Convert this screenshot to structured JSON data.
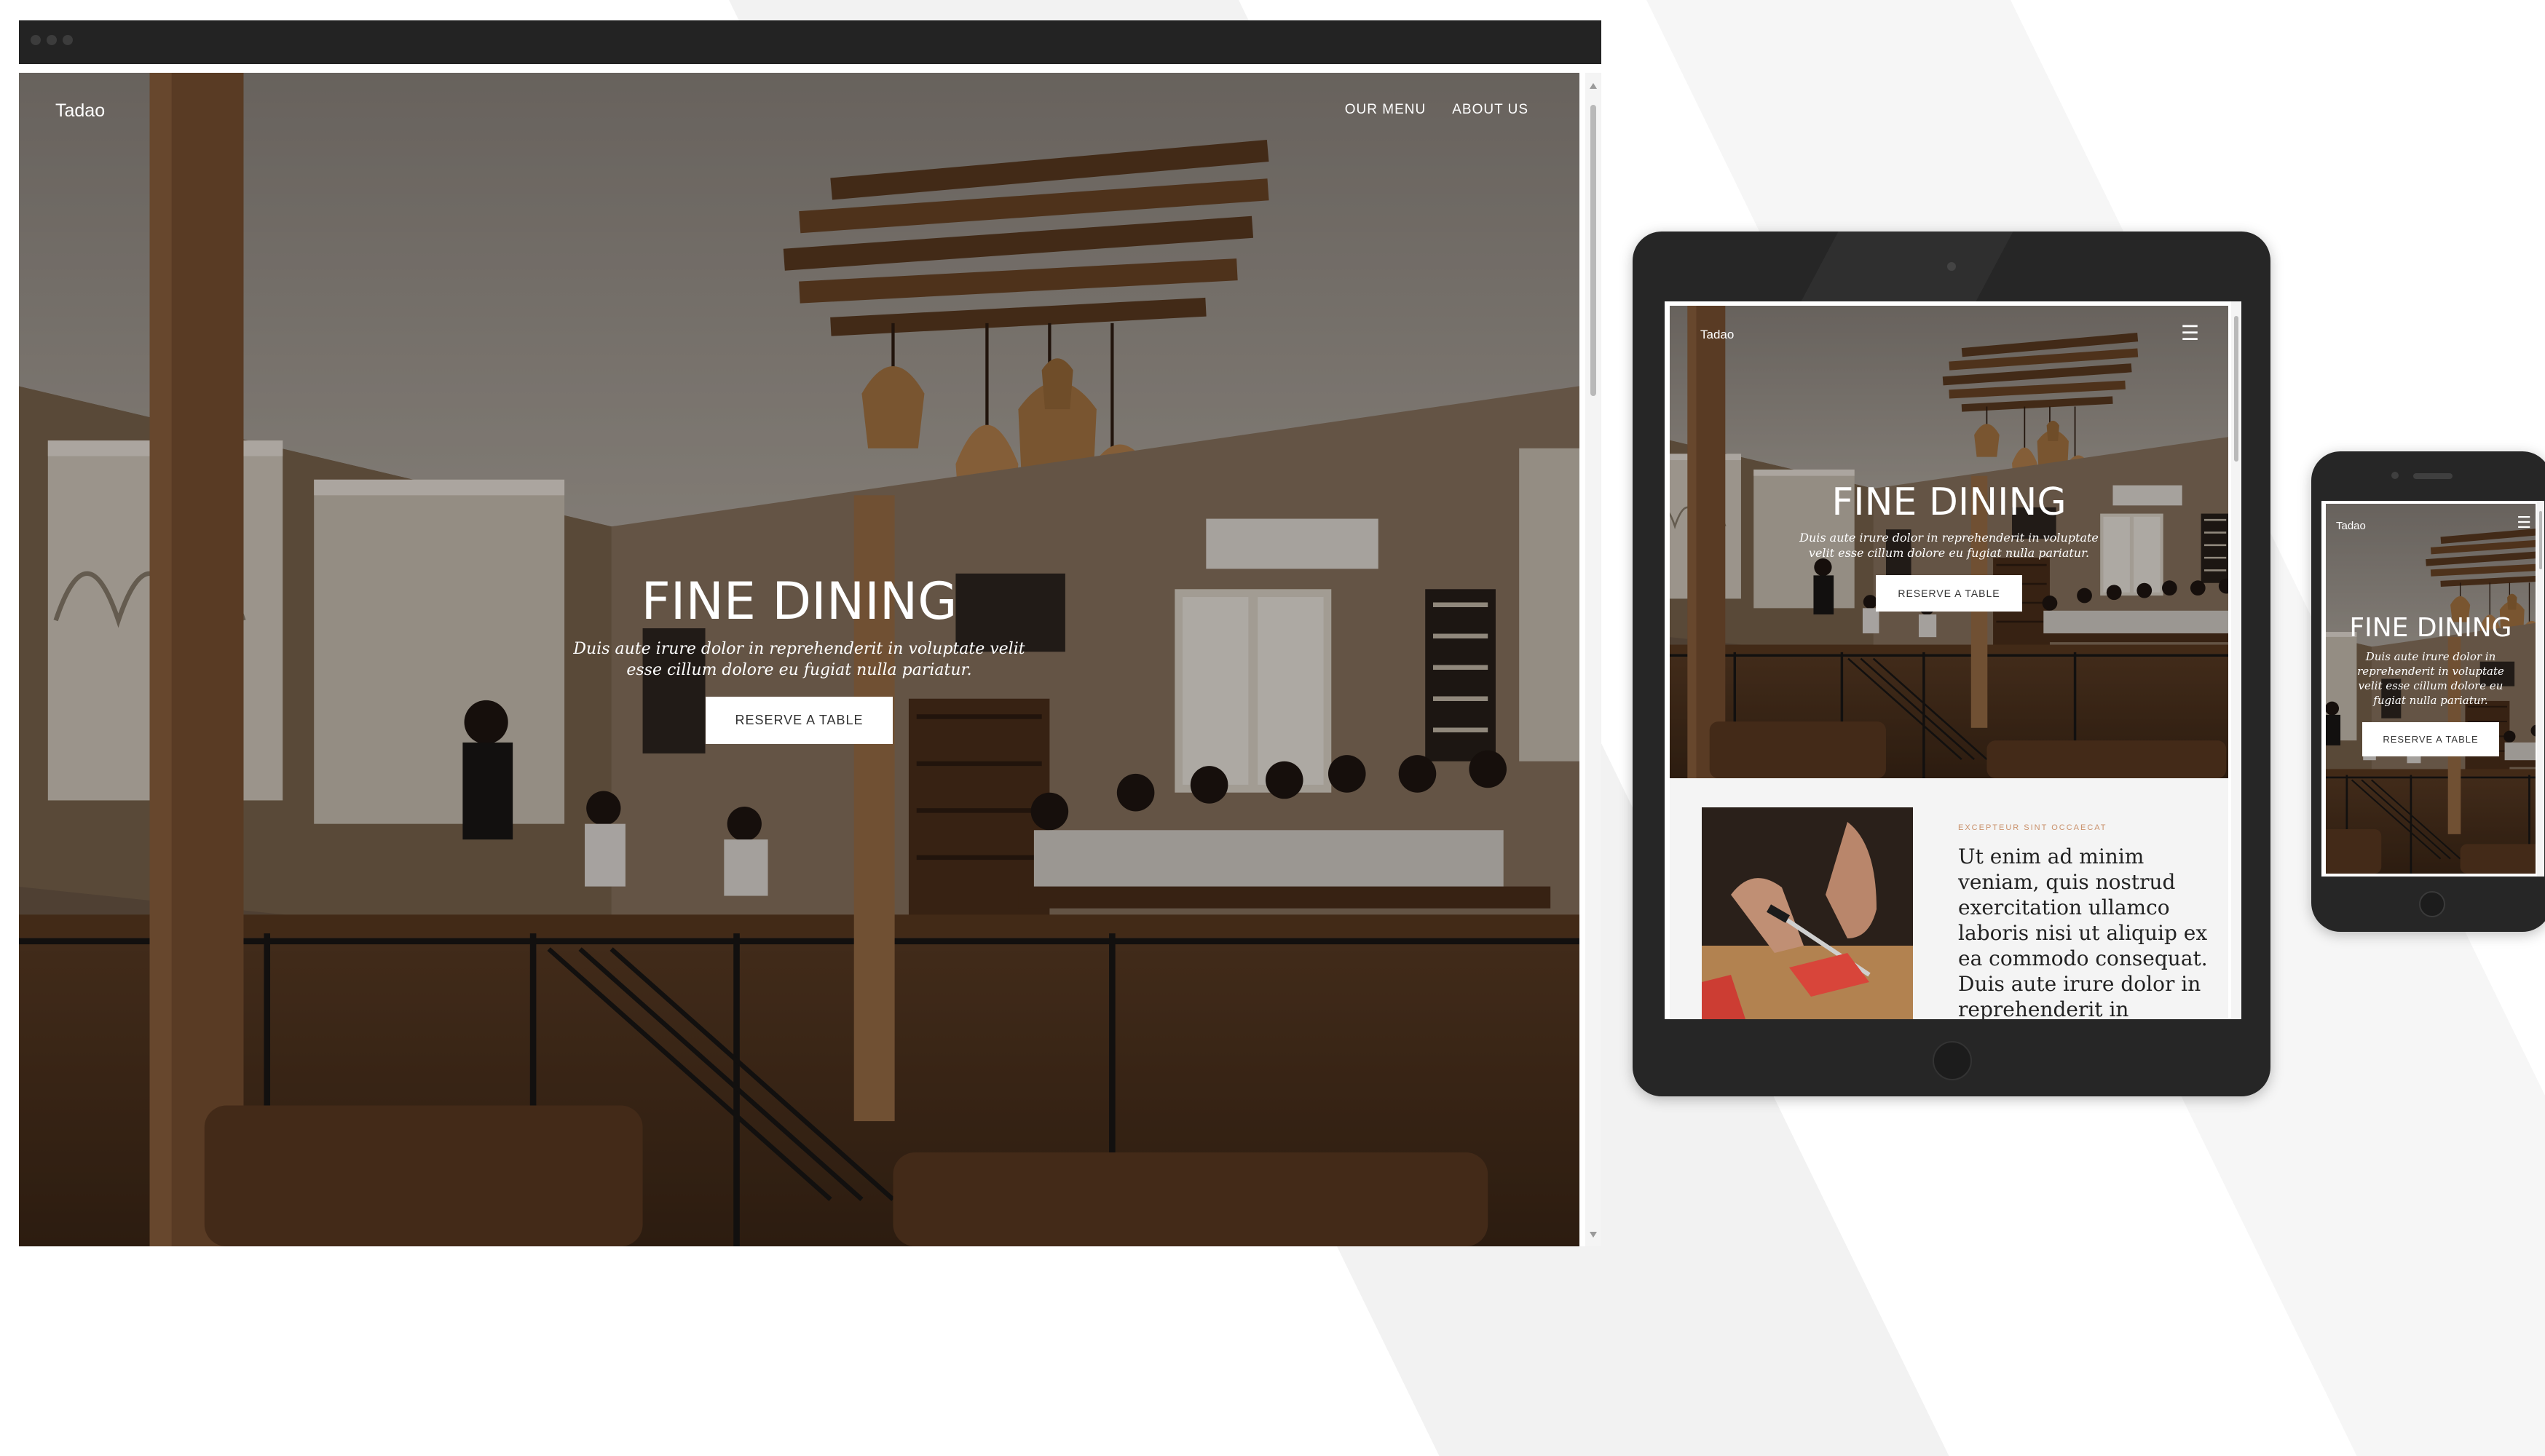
{
  "site": {
    "brand": "Tadao",
    "nav": [
      {
        "label": "OUR MENU"
      },
      {
        "label": "ABOUT US"
      }
    ],
    "hero": {
      "title": "FINE DINING",
      "subtitle": "Duis aute irure dolor in reprehenderit in voluptate velit esse cillum dolore eu fugiat nulla pariatur.",
      "cta": "RESERVE A TABLE"
    },
    "section": {
      "eyebrow": "EXCEPTEUR SINT OCCAECAT",
      "paragraph": "Ut enim ad minim veniam, quis nostrud exercitation ullamco laboris nisi ut aliquip ex ea commodo consequat. Duis aute irure dolor in reprehenderit in"
    }
  },
  "icons": {
    "menu": "hamburger-icon",
    "window_controls": "window-dot-icon",
    "scroll_up": "arrow-up-icon",
    "scroll_down": "arrow-down-icon"
  },
  "colors": {
    "device_frame": "#262626",
    "browser_titlebar": "#232323",
    "accent_eyebrow": "#c9906a",
    "button_bg": "#ffffff",
    "button_text": "#333333"
  }
}
